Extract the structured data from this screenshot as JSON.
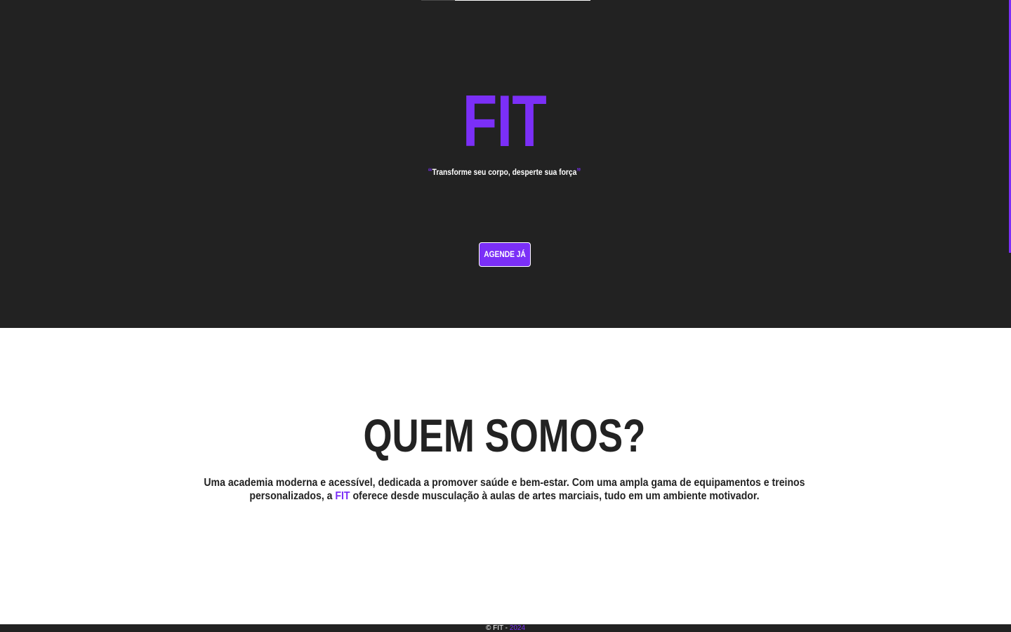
{
  "colors": {
    "accent": "#7b2ff7",
    "dark": "#222222",
    "light": "#ffffff"
  },
  "hero": {
    "logo": "FIT",
    "slogan_open_quote": "“",
    "slogan": "Transforme seu corpo, desperte sua força",
    "slogan_close_quote": "”",
    "cta_label": "AGENDE JÁ"
  },
  "about": {
    "title": "QUEM SOMOS?",
    "text_before": "Uma academia moderna e acessível, dedicada a promover saúde e bem-estar. Com uma ampla gama de equipamentos e treinos personalizados, a ",
    "brand": "FIT",
    "text_after": " oferece desde musculação à aulas de artes marciais, tudo em um ambiente motivador."
  },
  "footer": {
    "copyright": "© FIT - ",
    "year": "2024"
  }
}
